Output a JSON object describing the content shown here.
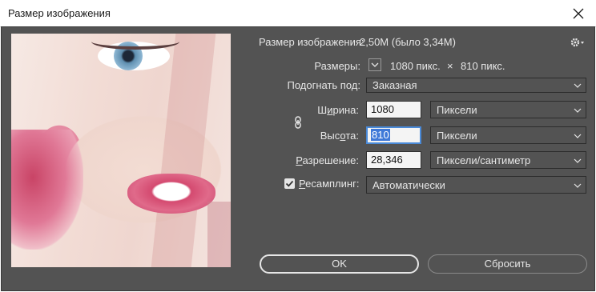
{
  "window": {
    "title": "Размер изображения",
    "close_icon": "close-icon"
  },
  "info": {
    "size_label": "Размер изображения:",
    "size_value": "2,50М (было 3,34М)",
    "gear_icon": "gear-icon",
    "dims_label": "Размеры:",
    "dims_width": "1080 пикс.",
    "dims_sep": "×",
    "dims_height": "810 пикс."
  },
  "fit": {
    "label": "Подогнать под:",
    "value": "Заказная"
  },
  "width": {
    "label_pre": "Ш",
    "label_u": "и",
    "label_post": "рина:",
    "value": "1080",
    "unit": "Пиксели"
  },
  "height": {
    "label_pre": "Выс",
    "label_u": "о",
    "label_post": "та:",
    "value": "810",
    "unit": "Пиксели"
  },
  "resolution": {
    "label_u": "Р",
    "label_post": "азрешение:",
    "value": "28,346",
    "unit": "Пиксели/сантиметр"
  },
  "resample": {
    "label_u": "Р",
    "label_post": "есамплинг:",
    "checked": true,
    "value": "Автоматически"
  },
  "buttons": {
    "ok": "OK",
    "reset": "Сбросить"
  },
  "colors": {
    "panel": "#535353",
    "text": "#e6e6e6",
    "focus": "#4a8ad8"
  }
}
